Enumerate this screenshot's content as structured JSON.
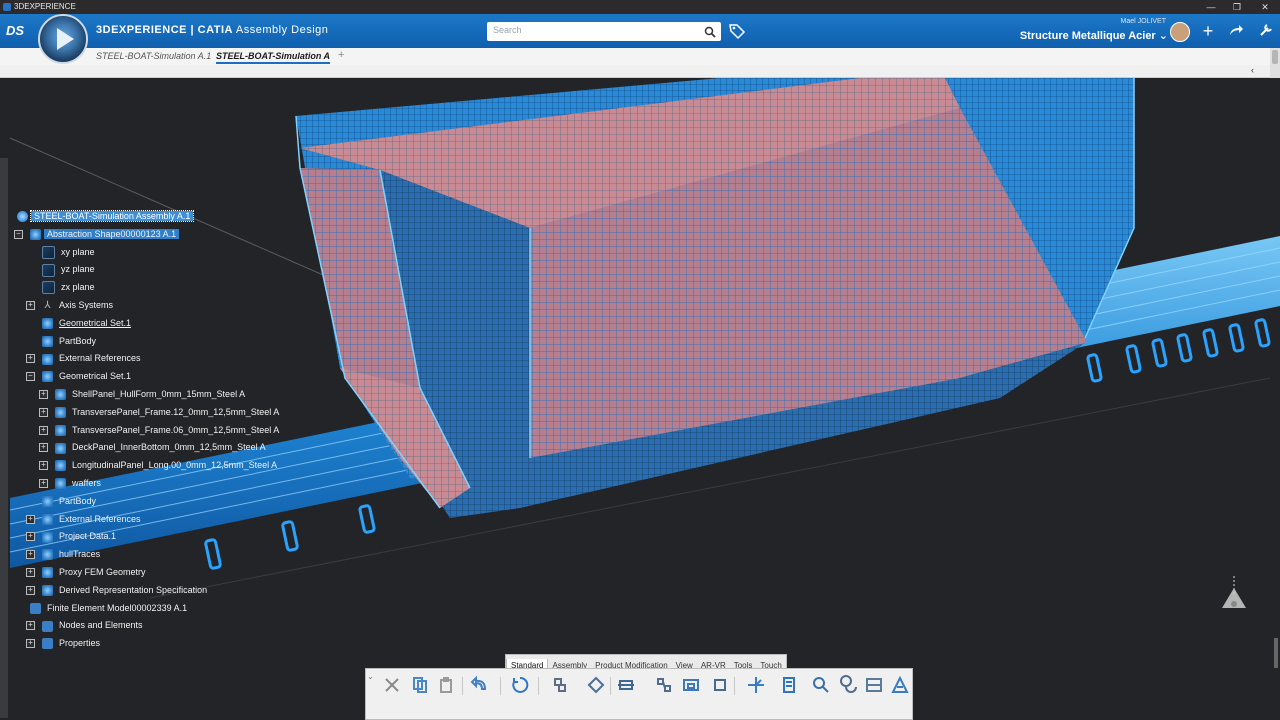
{
  "window": {
    "title": "3DEXPERIENCE",
    "controls": [
      "—",
      "❐",
      "✕"
    ]
  },
  "header": {
    "brand_prefix": "3D",
    "brand_main": "EXPERIENCE | CATIA",
    "brand_app": "Assembly Design",
    "search_placeholder": "Search",
    "user_name": "Mael JOLIVET",
    "workspace": "Structure Metallique Acier",
    "workspace_caret": "⌄"
  },
  "tabs": [
    {
      "label": "STEEL-BOAT-Simulation A.1",
      "active": false
    },
    {
      "label": "STEEL-BOAT-Simulation A",
      "active": true
    }
  ],
  "tree": [
    {
      "label": "STEEL-BOAT-Simulation Assembly A.1",
      "level": 0,
      "icon": "assembly-icon",
      "expander": "",
      "style": "sel"
    },
    {
      "label": "Abstraction Shape00000123 A.1",
      "level": 1,
      "icon": "part-icon",
      "expander": "−",
      "style": "hl"
    },
    {
      "label": "xy plane",
      "level": 2,
      "icon": "plane-icon",
      "expander": "",
      "style": ""
    },
    {
      "label": "yz plane",
      "level": 2,
      "icon": "plane-icon",
      "expander": "",
      "style": ""
    },
    {
      "label": "zx plane",
      "level": 2,
      "icon": "plane-icon",
      "expander": "",
      "style": ""
    },
    {
      "label": "Axis Systems",
      "level": 2,
      "icon": "axis-icon",
      "expander": "+",
      "style": ""
    },
    {
      "label": "Geometrical Set.1",
      "level": 2,
      "icon": "part-icon",
      "expander": "",
      "style": "ul"
    },
    {
      "label": "PartBody",
      "level": 2,
      "icon": "part-icon",
      "expander": "",
      "style": ""
    },
    {
      "label": "External References",
      "level": 2,
      "icon": "part-icon",
      "expander": "+",
      "style": ""
    },
    {
      "label": "Geometrical Set.1",
      "level": 2,
      "icon": "part-icon",
      "expander": "−",
      "style": ""
    },
    {
      "label": "ShellPanel_HullForm_0mm_15mm_Steel A",
      "level": 3,
      "icon": "part-icon",
      "expander": "+",
      "style": ""
    },
    {
      "label": "TransversePanel_Frame.12_0mm_12,5mm_Steel A",
      "level": 3,
      "icon": "part-icon",
      "expander": "+",
      "style": ""
    },
    {
      "label": "TransversePanel_Frame.06_0mm_12,5mm_Steel A",
      "level": 3,
      "icon": "part-icon",
      "expander": "+",
      "style": ""
    },
    {
      "label": "DeckPanel_InnerBottom_0mm_12,5mm_Steel A",
      "level": 3,
      "icon": "part-icon",
      "expander": "+",
      "style": ""
    },
    {
      "label": "LongitudinalPanel_Long.00_0mm_12,5mm_Steel A",
      "level": 3,
      "icon": "part-icon",
      "expander": "+",
      "style": ""
    },
    {
      "label": "waffers",
      "level": 3,
      "icon": "part-icon",
      "expander": "+",
      "style": ""
    },
    {
      "label": "PartBody",
      "level": 2,
      "icon": "part-icon",
      "expander": "",
      "style": ""
    },
    {
      "label": "External References",
      "level": 2,
      "icon": "part-icon",
      "expander": "+",
      "style": ""
    },
    {
      "label": "Project Data.1",
      "level": 2,
      "icon": "part-icon",
      "expander": "+",
      "style": ""
    },
    {
      "label": "hullTraces",
      "level": 2,
      "icon": "part-icon",
      "expander": "+",
      "style": ""
    },
    {
      "label": "Proxy FEM Geometry",
      "level": 2,
      "icon": "part-icon",
      "expander": "+",
      "style": ""
    },
    {
      "label": "Derived Representation Specification",
      "level": 2,
      "icon": "part-icon",
      "expander": "+",
      "style": ""
    },
    {
      "label": "Finite Element Model00002339 A.1",
      "level": 1,
      "icon": "fem-icon",
      "expander": "",
      "style": ""
    },
    {
      "label": "Nodes and Elements",
      "level": 2,
      "icon": "fem-icon",
      "expander": "+",
      "style": ""
    },
    {
      "label": "Properties",
      "level": 2,
      "icon": "fem-icon",
      "expander": "+",
      "style": ""
    }
  ],
  "action_bar": {
    "tabs": [
      {
        "label": "Standard",
        "active": true
      },
      {
        "label": "Assembly",
        "active": false
      },
      {
        "label": "Product Modification",
        "active": false
      },
      {
        "label": "View",
        "active": false
      },
      {
        "label": "AR-VR",
        "active": false
      },
      {
        "label": "Tools",
        "active": false
      },
      {
        "label": "Touch",
        "active": false
      }
    ],
    "tools": [
      "cut-icon",
      "copy-icon",
      "paste-icon",
      "undo-icon",
      "update-icon",
      "insert-product-icon",
      "replace-icon",
      "explode-icon",
      "engineering-connection-icon",
      "constraints-icon",
      "fix-icon",
      "compass-icon",
      "check-icon",
      "zoom-icon",
      "clash-icon",
      "section-icon",
      "measure-icon"
    ]
  },
  "colors": {
    "header_blue": "#1768b8",
    "selection_blue": "#3e8fd8",
    "mesh_pink": "#c9868f",
    "mesh_blue": "#2e9be6",
    "viewport_bg": "#232427"
  }
}
